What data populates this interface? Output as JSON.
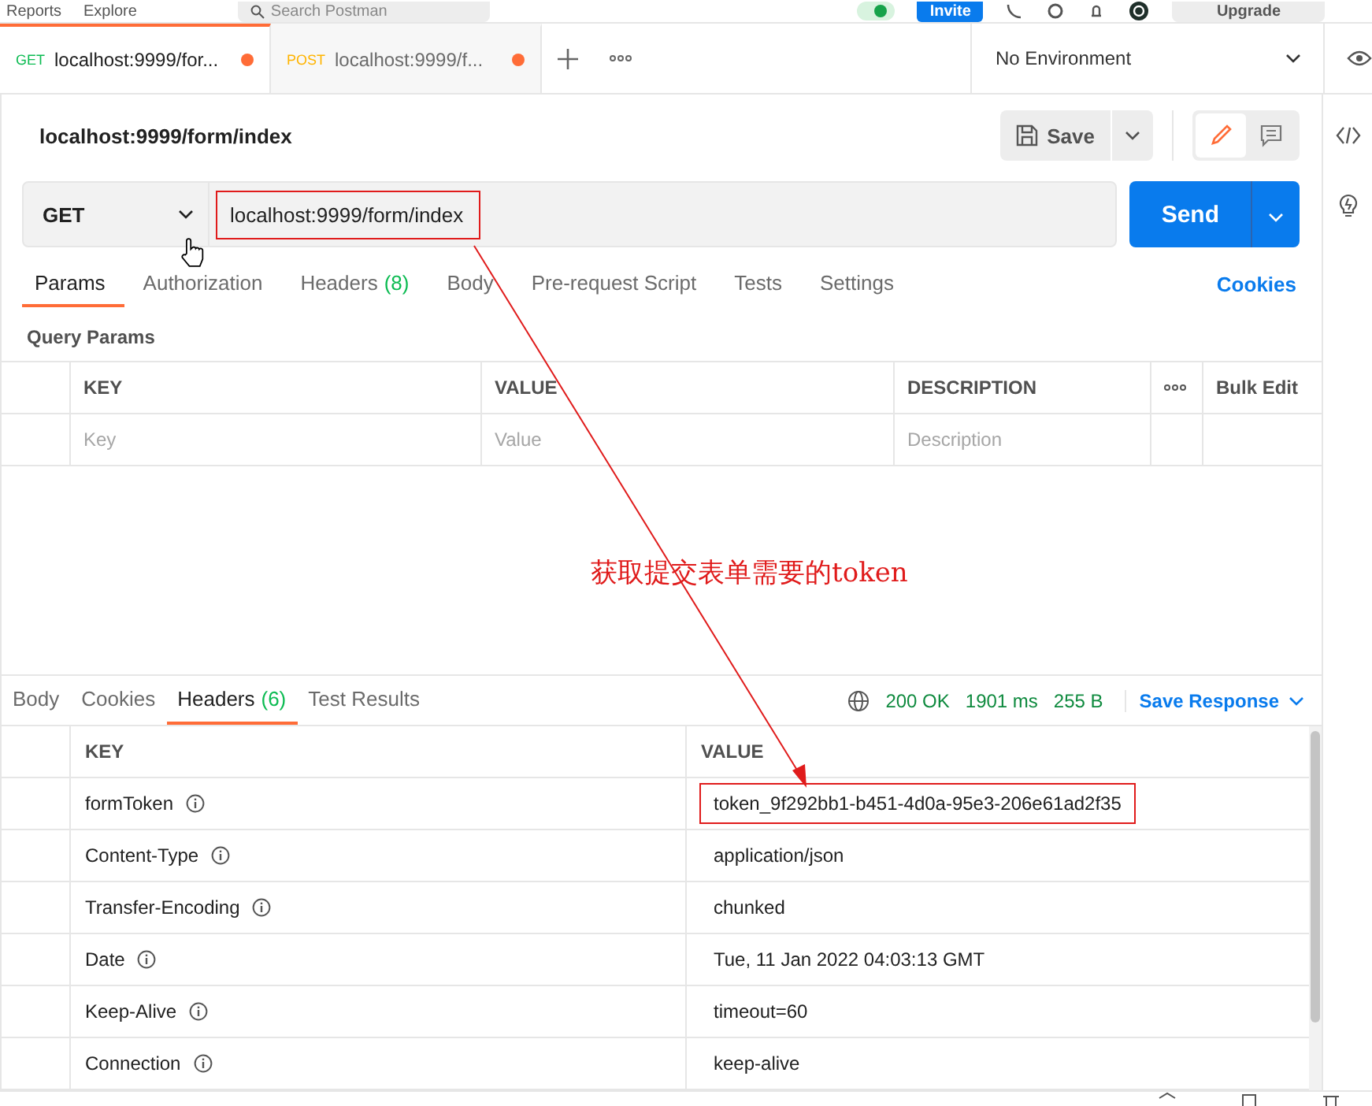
{
  "top_bar": {
    "nav": [
      "Reports",
      "Explore"
    ],
    "search": {
      "placeholder": "Search Postman"
    },
    "invite": "Invite",
    "upgrade": "Upgrade"
  },
  "tabs": [
    {
      "method": "GET",
      "label": "localhost:9999/for...",
      "selected": true,
      "unsaved": true
    },
    {
      "method": "POST",
      "label": "localhost:9999/f...",
      "selected": false,
      "unsaved": true
    }
  ],
  "environment": "No Environment",
  "request": {
    "title": "localhost:9999/form/index",
    "save": "Save",
    "method": "GET",
    "url": "localhost:9999/form/index",
    "url_highlighted": true,
    "send": "Send"
  },
  "request_tabs": [
    {
      "label": "Params",
      "selected": true
    },
    {
      "label": "Authorization",
      "selected": false
    },
    {
      "label": "Headers",
      "count": "(8)",
      "selected": false
    },
    {
      "label": "Body",
      "selected": false
    },
    {
      "label": "Pre-request Script",
      "selected": false
    },
    {
      "label": "Tests",
      "selected": false
    },
    {
      "label": "Settings",
      "selected": false
    }
  ],
  "cookies": "Cookies",
  "query_params": {
    "title": "Query Params",
    "columns": [
      "KEY",
      "VALUE",
      "DESCRIPTION"
    ],
    "bulk_edit": "Bulk Edit",
    "placeholders": [
      "Key",
      "Value",
      "Description"
    ]
  },
  "annotation": "获取提交表单需要的token",
  "response": {
    "tabs": [
      {
        "label": "Body",
        "selected": false
      },
      {
        "label": "Cookies",
        "selected": false
      },
      {
        "label": "Headers",
        "count": "(6)",
        "selected": true
      },
      {
        "label": "Test Results",
        "selected": false
      }
    ],
    "status": "200 OK",
    "time": "1901 ms",
    "size": "255 B",
    "save_response": "Save Response",
    "columns": [
      "KEY",
      "VALUE"
    ],
    "rows": [
      {
        "key": "formToken",
        "value": "token_9f292bb1-b451-4d0a-95e3-206e61ad2f35",
        "highlighted": true
      },
      {
        "key": "Content-Type",
        "value": "application/json",
        "highlighted": false
      },
      {
        "key": "Transfer-Encoding",
        "value": "chunked",
        "highlighted": false
      },
      {
        "key": "Date",
        "value": "Tue, 11 Jan 2022 04:03:13 GMT",
        "highlighted": false
      },
      {
        "key": "Keep-Alive",
        "value": "timeout=60",
        "highlighted": false
      },
      {
        "key": "Connection",
        "value": "keep-alive",
        "highlighted": false
      }
    ]
  }
}
